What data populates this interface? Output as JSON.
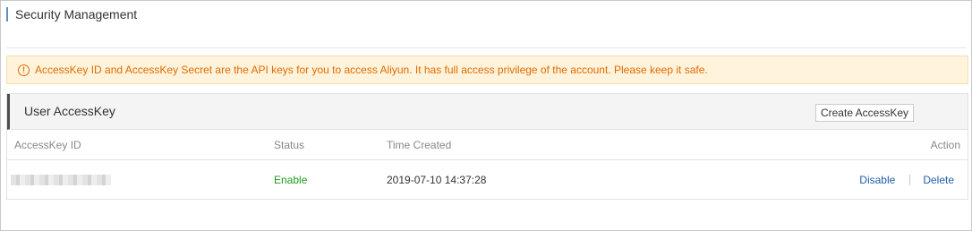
{
  "page": {
    "title": "Security Management"
  },
  "alert": {
    "icon": "warning-circle-icon",
    "text": "AccessKey ID and AccessKey Secret are the API keys for you to access Aliyun. It has full access privilege of the account. Please keep it safe."
  },
  "panel": {
    "title": "User AccessKey",
    "create_label": "Create AccessKey",
    "columns": {
      "id": "AccessKey ID",
      "status": "Status",
      "time": "Time Created",
      "action": "Action"
    },
    "rows": [
      {
        "status": "Enable",
        "time": "2019-07-10 14:37:28",
        "disable_label": "Disable",
        "delete_label": "Delete"
      }
    ]
  },
  "colors": {
    "accent_bar": "#5a8fc9",
    "alert_text": "#e06c00",
    "alert_bg": "#fff3dc",
    "status_enabled": "#1a9f1a",
    "link": "#1f5fa8"
  }
}
